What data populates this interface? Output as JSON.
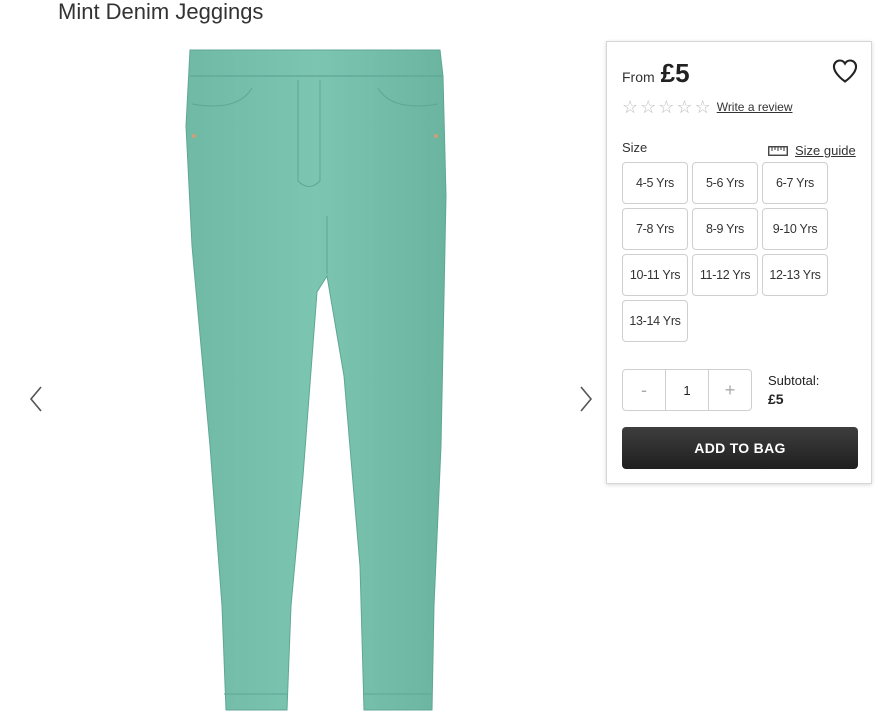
{
  "product": {
    "title": "Mint Denim Jeggings"
  },
  "buybox": {
    "from_label": "From",
    "price": "£5",
    "review_link": "Write a review",
    "rating": 0,
    "rating_max": 5,
    "size_label": "Size",
    "size_guide": "Size guide",
    "sizes": [
      "4-5 Yrs",
      "5-6 Yrs",
      "6-7 Yrs",
      "7-8 Yrs",
      "8-9 Yrs",
      "9-10 Yrs",
      "10-11 Yrs",
      "11-12 Yrs",
      "12-13 Yrs",
      "13-14 Yrs"
    ],
    "quantity": {
      "minus": "-",
      "value": "1",
      "plus": "+"
    },
    "subtotal_label": "Subtotal:",
    "subtotal_value": "£5",
    "add_to_bag": "ADD TO BAG"
  },
  "icons": {
    "prev": "chevron-left-icon",
    "next": "chevron-right-icon",
    "wishlist": "heart-outline-icon",
    "size_guide": "ruler-icon",
    "star": "star-outline-icon"
  },
  "colors": {
    "product": "#79c1ae",
    "button": "#2a2a2a",
    "star_empty": "#bdbdbd"
  }
}
